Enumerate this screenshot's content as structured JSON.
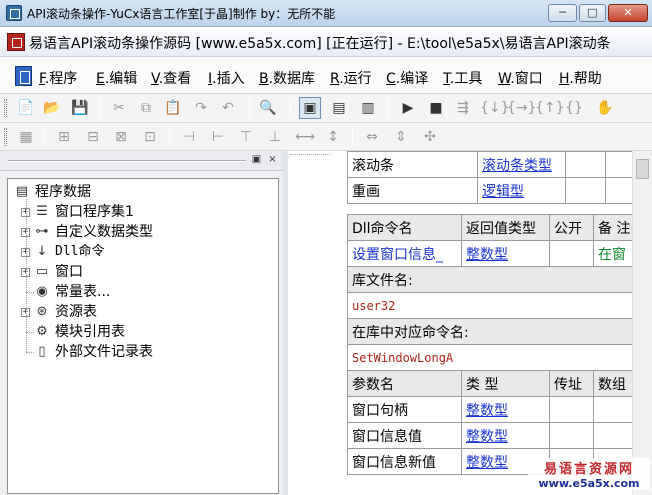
{
  "window": {
    "title": "API滚动条操作-YuCx语言工作室[于晶]制作 by：无所不能",
    "controls": {
      "minimize": "─",
      "maximize": "□",
      "close": "✕"
    }
  },
  "caption": {
    "text": "易语言API滚动条操作源码 [www.e5a5x.com] [正在运行] - E:\\tool\\e5a5x\\易语言API滚动条"
  },
  "menu": {
    "items": [
      {
        "key": "F",
        "label": ".程序"
      },
      {
        "key": "E",
        "label": ".编辑"
      },
      {
        "key": "V",
        "label": ".查看"
      },
      {
        "key": "I",
        "label": ".插入"
      },
      {
        "key": "B",
        "label": ".数据库"
      },
      {
        "key": "R",
        "label": ".运行"
      },
      {
        "key": "C",
        "label": ".编译"
      },
      {
        "key": "T",
        "label": ".工具"
      },
      {
        "key": "W",
        "label": ".窗口"
      },
      {
        "key": "H",
        "label": ".帮助"
      }
    ]
  },
  "toolbar1": {
    "icons": [
      "new-file-icon",
      "open-folder-icon",
      "save-icon",
      "cut-icon",
      "copy-icon",
      "paste-icon",
      "redo-icon",
      "undo-icon",
      "find-icon",
      "layout-view-1-icon",
      "layout-view-2-icon",
      "layout-view-3-icon",
      "run-icon",
      "stop-icon",
      "step-icon",
      "step-into-icon",
      "step-over-icon",
      "step-out-icon",
      "run-to-cursor-icon",
      "hand-icon"
    ],
    "glyphs": [
      "📄",
      "📂",
      "💾",
      "✂",
      "⧉",
      "📋",
      "↷",
      "↶",
      "🔍",
      "▣",
      "▤",
      "▥",
      "▶",
      "■",
      "⇶",
      "{↓}",
      "{→}",
      "{↑}",
      "{}",
      "✋"
    ]
  },
  "toolbar2": {
    "icons": [
      "align-left-icon",
      "align-right-icon",
      "align-top-icon",
      "align-bottom-icon",
      "center-h-icon",
      "center-v-icon",
      "same-width-icon",
      "same-height-icon",
      "same-size-icon",
      "h-space-icon",
      "v-space-icon",
      "bring-front-icon",
      "send-back-icon",
      "grid-icon"
    ],
    "glyphs": [
      "▦",
      "⊞",
      "⊟",
      "⊠",
      "⊡",
      "⊣",
      "⊢",
      "⊤",
      "⊥",
      "⟷",
      "↕",
      "⇔",
      "⇕",
      "✣"
    ]
  },
  "left_panel": {
    "header_buttons": {
      "dock": "▣",
      "close": "×"
    },
    "tree": [
      {
        "label": "程序数据",
        "icon": "program-data-icon",
        "glyph": "▤",
        "expander": "",
        "mono": false
      },
      {
        "label": "窗口程序集1",
        "icon": "assembly-icon",
        "glyph": "☰",
        "expander": "+",
        "mono": false
      },
      {
        "label": "自定义数据类型",
        "icon": "custom-type-icon",
        "glyph": "⊶",
        "expander": "+",
        "mono": false
      },
      {
        "label": "Dll命令",
        "icon": "dll-command-icon",
        "glyph": "↓",
        "expander": "+",
        "mono": true
      },
      {
        "label": "窗口",
        "icon": "window-icon",
        "glyph": "▭",
        "expander": "+",
        "mono": false
      },
      {
        "label": "常量表...",
        "icon": "constant-table-icon",
        "glyph": "◉",
        "expander": "",
        "mono": false
      },
      {
        "label": "资源表",
        "icon": "resource-table-icon",
        "glyph": "⊛",
        "expander": "+",
        "mono": false
      },
      {
        "label": "模块引用表",
        "icon": "module-ref-icon",
        "glyph": "⚙",
        "expander": "",
        "mono": false
      },
      {
        "label": "外部文件记录表",
        "icon": "external-file-icon",
        "glyph": "▯",
        "expander": "",
        "mono": false
      }
    ]
  },
  "editor": {
    "top_rows": [
      {
        "name": "滚动条",
        "type": "滚动条类型"
      },
      {
        "name": "重画",
        "type": "逻辑型"
      }
    ],
    "dll_header": [
      "Dll命令名",
      "返回值类型",
      "公开",
      "备 注"
    ],
    "dll_row": {
      "name": "设置窗口信息_",
      "return_type": "整数型",
      "public": "",
      "note": "在窗"
    },
    "lib_label": "库文件名:",
    "lib_value": "user32",
    "cmd_label": "在库中对应命令名:",
    "cmd_value": "SetWindowLongA",
    "param_header": [
      "参数名",
      "类 型",
      "传址",
      "数组"
    ],
    "params": [
      {
        "name": "窗口句柄",
        "type": "整数型"
      },
      {
        "name": "窗口信息值",
        "type": "整数型"
      },
      {
        "name": "窗口信息新值",
        "type": "整数型"
      }
    ]
  },
  "watermark": {
    "line1": "易语言资源网",
    "line2": "www.e5a5x.com"
  }
}
